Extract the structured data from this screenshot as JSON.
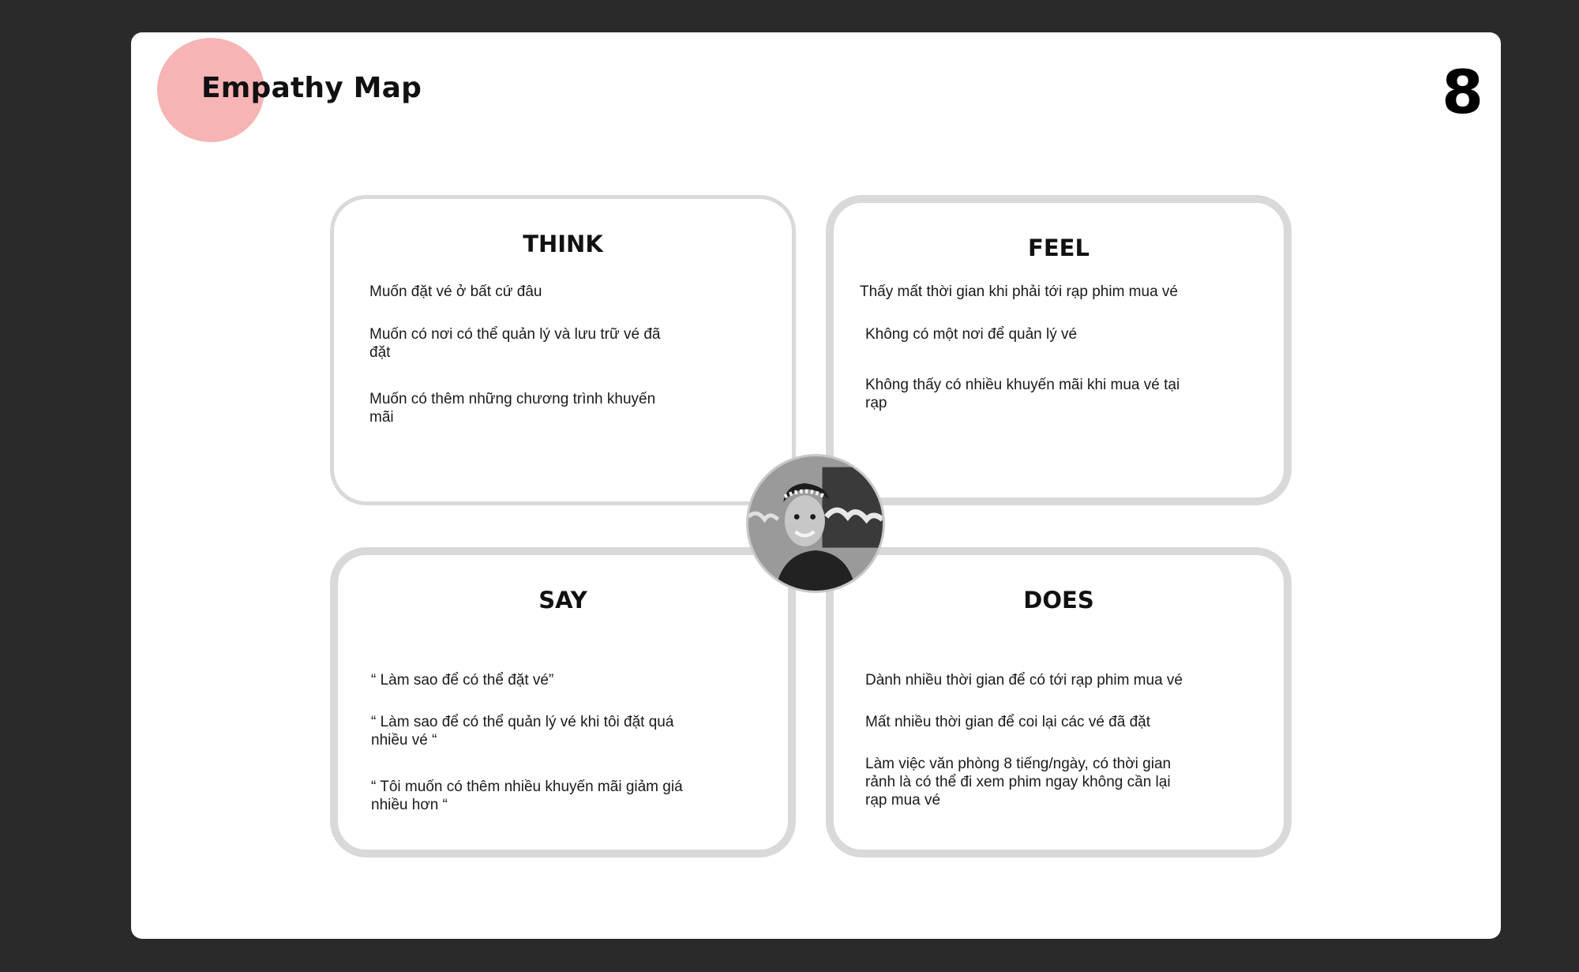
{
  "slide": {
    "title": "Empathy Map",
    "page_number": "8",
    "accent_color": "#f7b4b4"
  },
  "quadrants": {
    "think": {
      "heading": "THINK",
      "items": [
        "Muốn đặt vé ở bất cứ đâu",
        "Muốn có nơi có thể quản lý và lưu trữ vé đã đặt",
        "Muốn có thêm những chương trình khuyến mãi"
      ]
    },
    "feel": {
      "heading": "FEEL",
      "items": [
        "Thấy mất thời gian khi phải tới rạp phim mua vé",
        "Không có một nơi để quản lý vé",
        "Không thấy có nhiều khuyến mãi khi mua vé tại rạp"
      ]
    },
    "say": {
      "heading": "SAY",
      "items": [
        "“ Làm sao để có thể đặt vé”",
        "“ Làm sao để có thể quản lý vé khi tôi đặt quá nhiều vé “",
        "“ Tôi muốn có thêm nhiều khuyến mãi giảm giá nhiều hơn “"
      ]
    },
    "does": {
      "heading": "DOES",
      "items": [
        "Dành nhiều thời gian để có tới rạp phim mua vé",
        "Mất nhiều thời gian để coi lại các vé đã đặt",
        "Làm việc văn phòng 8 tiếng/ngày, có thời gian rảnh là có thể đi xem phim ngay không cần lại rạp mua vé"
      ]
    }
  },
  "persona": {
    "avatar_icon": "person-photo"
  }
}
